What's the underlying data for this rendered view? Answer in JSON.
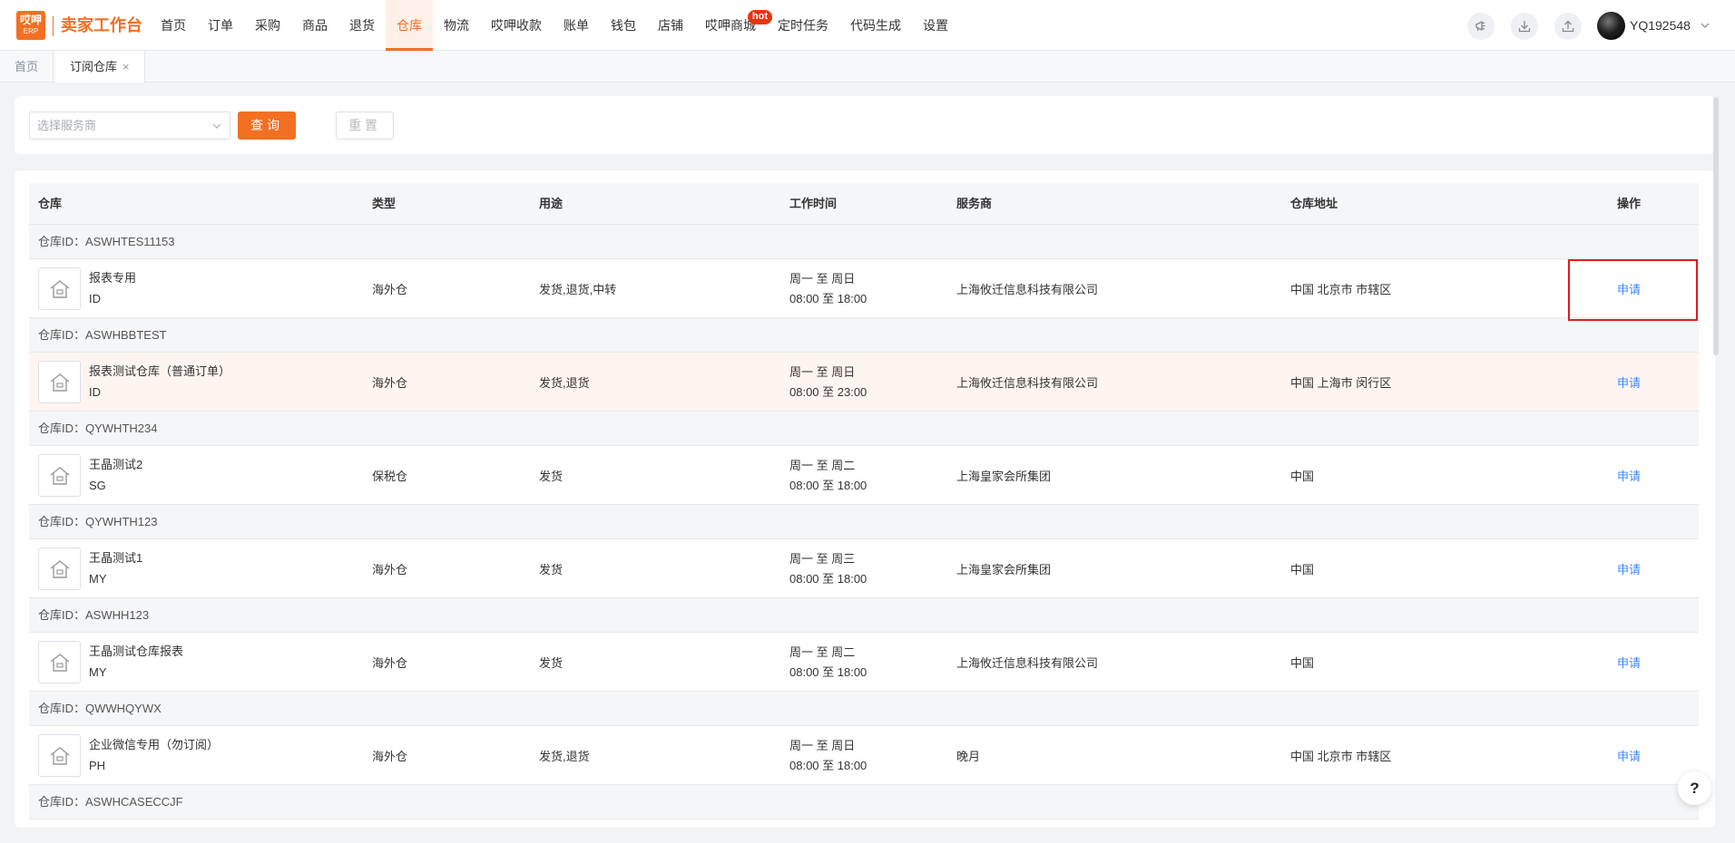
{
  "brand": {
    "logo_top": "哎呷",
    "logo_bottom": "ERP",
    "name": "卖家工作台"
  },
  "nav": {
    "items": [
      {
        "label": "首页"
      },
      {
        "label": "订单"
      },
      {
        "label": "采购"
      },
      {
        "label": "商品"
      },
      {
        "label": "退货"
      },
      {
        "label": "仓库"
      },
      {
        "label": "物流"
      },
      {
        "label": "哎呷收款"
      },
      {
        "label": "账单"
      },
      {
        "label": "钱包"
      },
      {
        "label": "店铺"
      },
      {
        "label": "哎呷商城"
      },
      {
        "label": "定时任务"
      },
      {
        "label": "代码生成"
      },
      {
        "label": "设置"
      }
    ],
    "active_index": 5,
    "hot_badge": "hot"
  },
  "user": {
    "name": "YQ192548"
  },
  "tabs": [
    {
      "label": "首页"
    },
    {
      "label": "订阅仓库",
      "close": "×"
    }
  ],
  "filter": {
    "select_placeholder": "选择服务商",
    "query_label": "查询",
    "reset_label": "重置"
  },
  "table": {
    "headers": {
      "warehouse": "仓库",
      "type": "类型",
      "usage": "用途",
      "work_time": "工作时间",
      "provider": "服务商",
      "address": "仓库地址",
      "action": "操作"
    },
    "groups": [
      {
        "id_label": "仓库ID：ASWHTES11153",
        "name": "报表专用",
        "code": "ID",
        "type": "海外仓",
        "usage": "发货,退货,中转",
        "days": "周一 至 周日",
        "hours": "08:00 至 18:00",
        "provider": "上海攸迁信息科技有限公司",
        "address": "中国 北京市 市辖区",
        "action": "申请"
      },
      {
        "id_label": "仓库ID：ASWHBBTEST",
        "name": "报表测试仓库（普通订单）",
        "code": "ID",
        "type": "海外仓",
        "usage": "发货,退货",
        "days": "周一 至 周日",
        "hours": "08:00 至 23:00",
        "provider": "上海攸迁信息科技有限公司",
        "address": "中国 上海市 闵行区",
        "action": "申请"
      },
      {
        "id_label": "仓库ID：QYWHTH234",
        "name": "王晶测试2",
        "code": "SG",
        "type": "保税仓",
        "usage": "发货",
        "days": "周一 至 周二",
        "hours": "08:00 至 18:00",
        "provider": "上海皇家会所集团",
        "address": "中国",
        "action": "申请"
      },
      {
        "id_label": "仓库ID：QYWHTH123",
        "name": "王晶测试1",
        "code": "MY",
        "type": "海外仓",
        "usage": "发货",
        "days": "周一 至 周三",
        "hours": "08:00 至 18:00",
        "provider": "上海皇家会所集团",
        "address": "中国",
        "action": "申请"
      },
      {
        "id_label": "仓库ID：ASWHH123",
        "name": "王晶测试仓库报表",
        "code": "MY",
        "type": "海外仓",
        "usage": "发货",
        "days": "周一 至 周二",
        "hours": "08:00 至 18:00",
        "provider": "上海攸迁信息科技有限公司",
        "address": "中国",
        "action": "申请"
      },
      {
        "id_label": "仓库ID：QWWHQYWX",
        "name": "企业微信专用（勿订阅）",
        "code": "PH",
        "type": "海外仓",
        "usage": "发货,退货",
        "days": "周一 至 周日",
        "hours": "08:00 至 18:00",
        "provider": "晚月",
        "address": "中国 北京市 市辖区",
        "action": "申请"
      },
      {
        "id_label": "仓库ID：ASWHCASECCJF"
      }
    ]
  },
  "help_label": "?",
  "colors": {
    "accent": "#f36f21",
    "link": "#3a86ff",
    "highlight_border": "#e31b1b",
    "hot_badge": "#e8340f"
  }
}
